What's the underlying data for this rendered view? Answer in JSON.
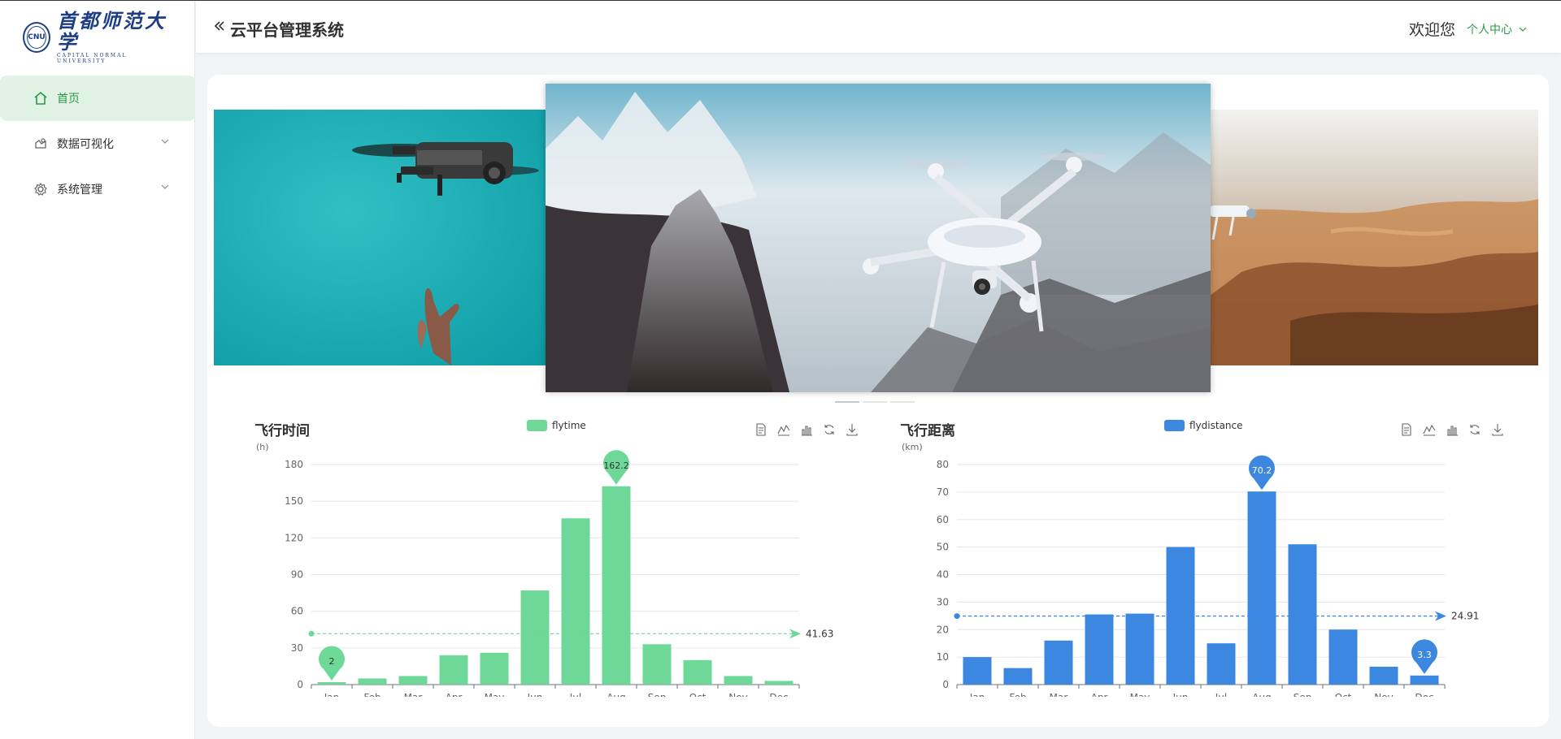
{
  "header": {
    "title": "云平台管理系统",
    "welcome": "欢迎您",
    "user_center": "个人中心"
  },
  "logo": {
    "seal_text": "CNU",
    "cn_name": "首都师范大学",
    "en_name": "CAPITAL NORMAL UNIVERSITY"
  },
  "sidebar": {
    "items": [
      {
        "label": "首页",
        "icon": "home-icon",
        "active": true
      },
      {
        "label": "数据可视化",
        "icon": "chart-icon",
        "active": false,
        "expandable": true
      },
      {
        "label": "系统管理",
        "icon": "gear-icon",
        "active": false,
        "expandable": true
      }
    ]
  },
  "carousel": {
    "slides": [
      "drone-hand-teal",
      "drone-mountains",
      "drone-desert"
    ],
    "active_index": 1,
    "indicator_count": 3
  },
  "colors": {
    "accent": "#2c9a48",
    "flytime": "#6dd898",
    "flydistance": "#3c87e0"
  },
  "chart_data": [
    {
      "type": "bar",
      "title": "飞行时间",
      "unit_label": "(h)",
      "legend": "flytime",
      "categories": [
        "Jan",
        "Feb",
        "Mar",
        "Apr",
        "May",
        "Jun",
        "Jul",
        "Aug",
        "Sep",
        "Oct",
        "Nov",
        "Dec"
      ],
      "series": [
        {
          "name": "flytime",
          "values": [
            2,
            5,
            7,
            24,
            26,
            77,
            136,
            162.2,
            33,
            20,
            7,
            3
          ]
        }
      ],
      "ylim": [
        0,
        180
      ],
      "yticks": [
        0,
        30,
        60,
        90,
        120,
        150,
        180
      ],
      "mark_points": [
        {
          "label": "2",
          "index": 0
        },
        {
          "label": "162.2",
          "index": 7
        }
      ],
      "mark_line": {
        "label": "41.63",
        "value": 41.63
      },
      "grid": true,
      "legend_position": "top-center"
    },
    {
      "type": "bar",
      "title": "飞行距离",
      "unit_label": "(km)",
      "legend": "flydistance",
      "categories": [
        "Jan",
        "Feb",
        "Mar",
        "Apr",
        "May",
        "Jun",
        "Jul",
        "Aug",
        "Sep",
        "Oct",
        "Nov",
        "Dec"
      ],
      "series": [
        {
          "name": "flydistance",
          "values": [
            10,
            6,
            16,
            25.5,
            25.8,
            50,
            15,
            70.2,
            51,
            20,
            6.5,
            3.3
          ]
        }
      ],
      "ylim": [
        0,
        80
      ],
      "yticks": [
        0,
        10,
        20,
        30,
        40,
        50,
        60,
        70,
        80
      ],
      "mark_points": [
        {
          "label": "70.2",
          "index": 7
        },
        {
          "label": "3.3",
          "index": 11
        }
      ],
      "mark_line": {
        "label": "24.91",
        "value": 24.91
      },
      "grid": true,
      "legend_position": "top-center"
    }
  ]
}
